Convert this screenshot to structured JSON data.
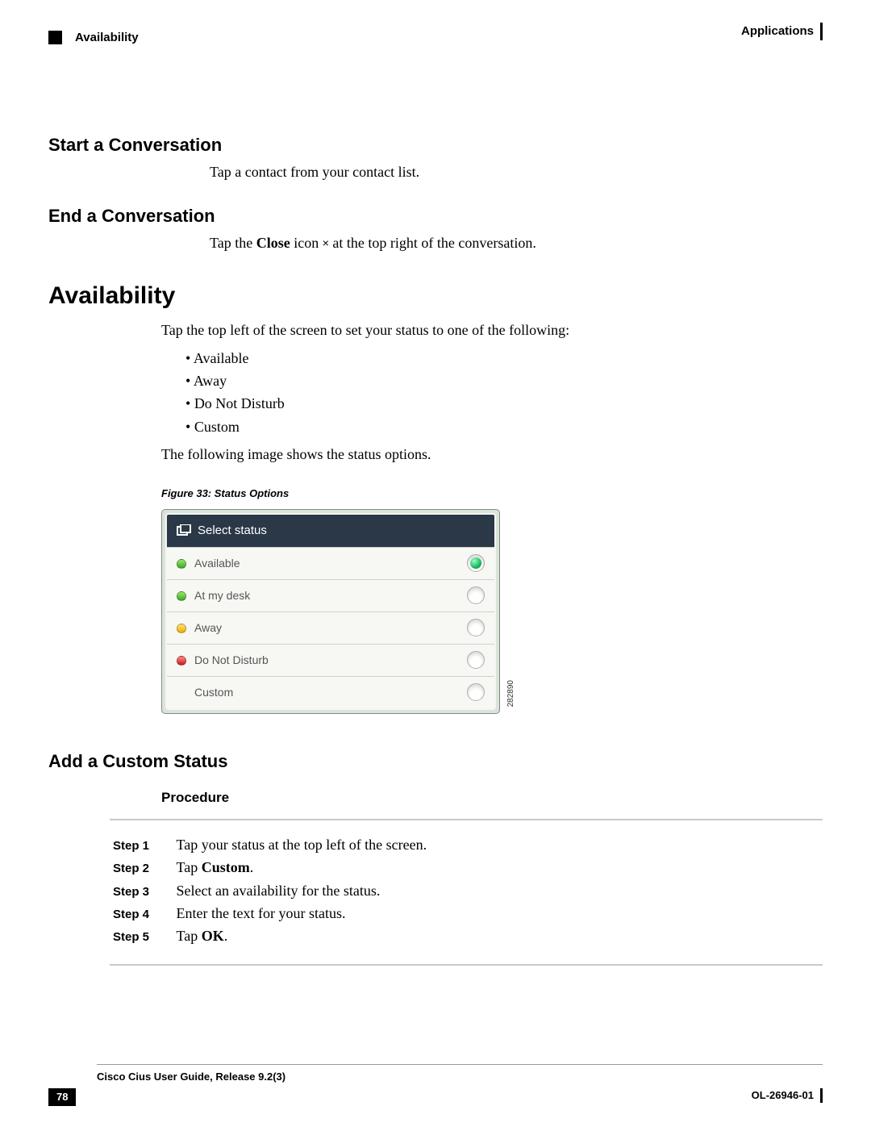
{
  "header": {
    "left": "Availability",
    "right": "Applications"
  },
  "s1": {
    "title": "Start a Conversation",
    "p1": "Tap a contact from your contact list."
  },
  "s2": {
    "title": "End a Conversation",
    "p_pre": "Tap the ",
    "p_bold1": "Close",
    "p_mid": " icon ",
    "close_glyph": "×",
    "p_post": " at the top right of the conversation."
  },
  "s3": {
    "title": "Availability",
    "intro": "Tap the top left of the screen to set your status to one of the following:",
    "items": [
      "Available",
      "Away",
      "Do Not Disturb",
      "Custom"
    ],
    "after": "The following image shows the status options.",
    "figcap": "Figure 33: Status Options",
    "fig": {
      "header": "Select status",
      "rows": [
        {
          "label": "Available",
          "dot": "green",
          "selected": true
        },
        {
          "label": "At my desk",
          "dot": "green",
          "selected": false
        },
        {
          "label": "Away",
          "dot": "yellow",
          "selected": false
        },
        {
          "label": "Do Not Disturb",
          "dot": "red",
          "selected": false
        },
        {
          "label": "Custom",
          "dot": "",
          "selected": false
        }
      ],
      "id": "282890"
    }
  },
  "s4": {
    "title": "Add a Custom Status",
    "proc": "Procedure",
    "steps": [
      {
        "label": "Step 1",
        "text_pre": "Tap your status at the top left of the screen.",
        "bold": "",
        "text_post": ""
      },
      {
        "label": "Step 2",
        "text_pre": "Tap ",
        "bold": "Custom",
        "text_post": "."
      },
      {
        "label": "Step 3",
        "text_pre": "Select an availability for the status.",
        "bold": "",
        "text_post": ""
      },
      {
        "label": "Step 4",
        "text_pre": "Enter the text for your status.",
        "bold": "",
        "text_post": ""
      },
      {
        "label": "Step 5",
        "text_pre": "Tap ",
        "bold": "OK",
        "text_post": "."
      }
    ]
  },
  "footer": {
    "title": "Cisco Cius User Guide, Release 9.2(3)",
    "page": "78",
    "docnum": "OL-26946-01"
  }
}
